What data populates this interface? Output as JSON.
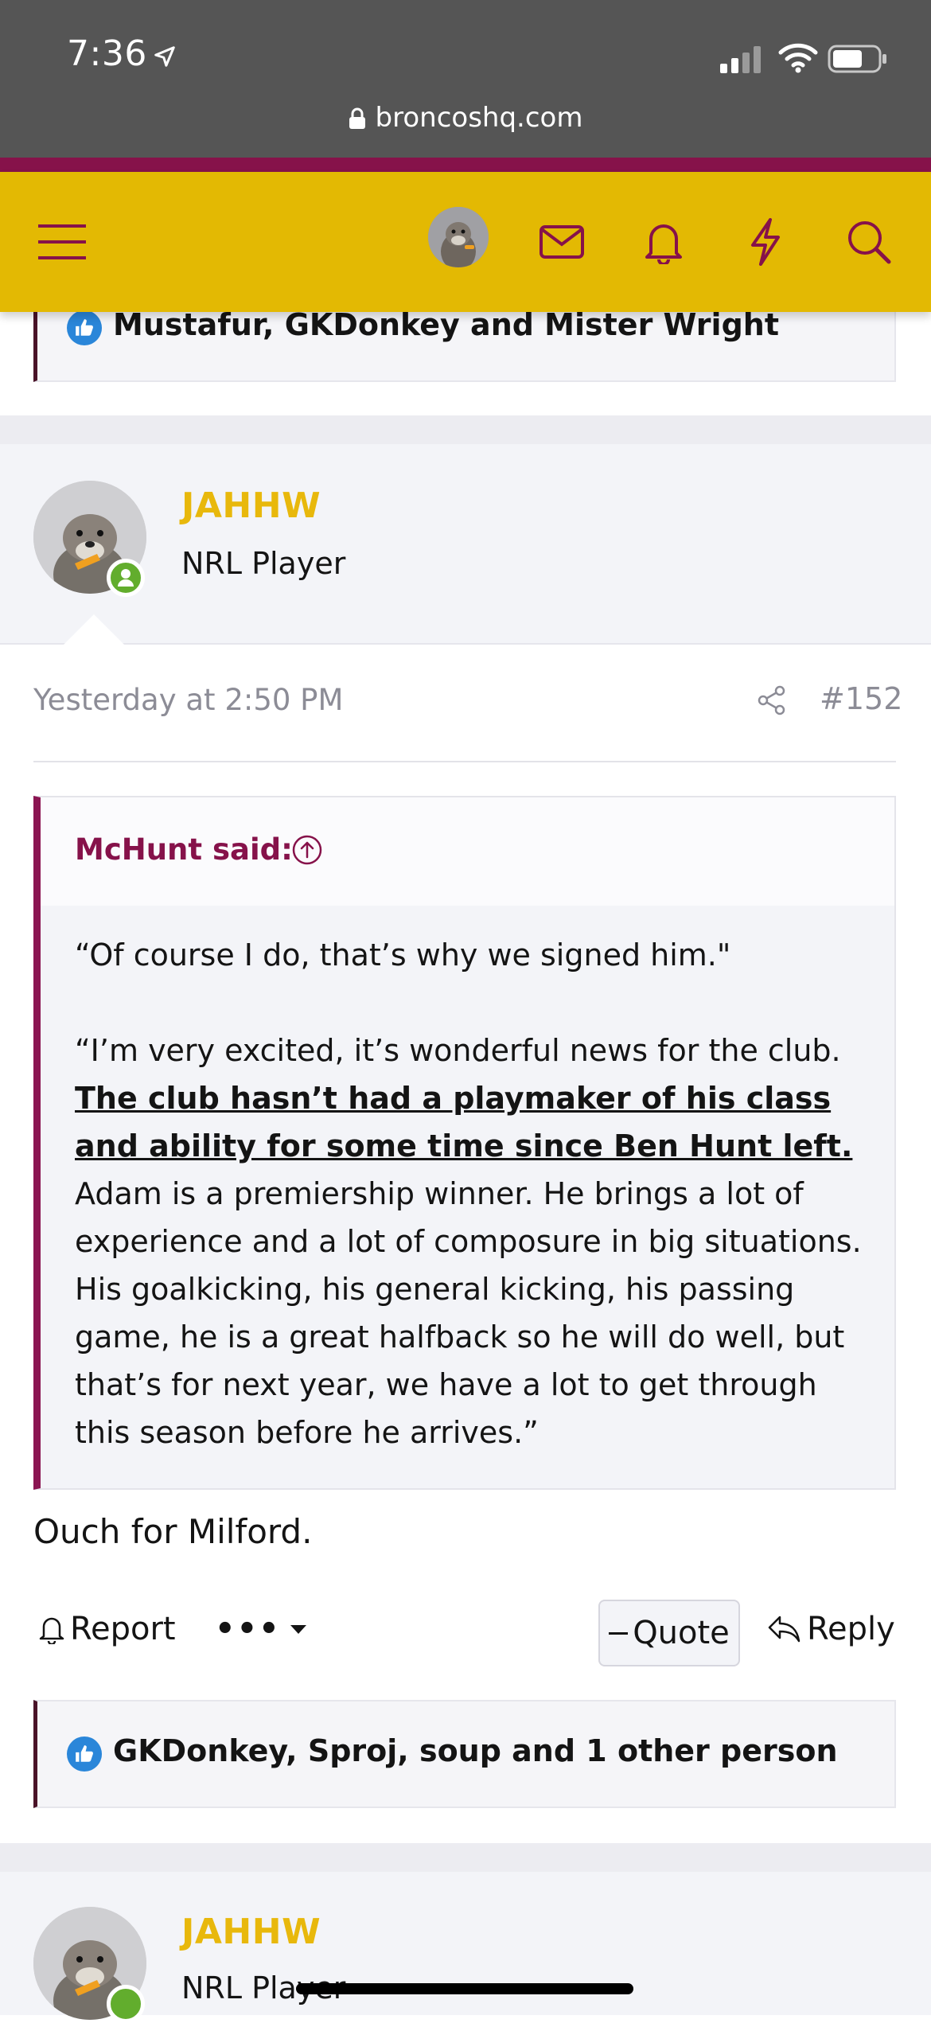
{
  "status_bar": {
    "time": "7:36",
    "url": "broncoshq.com"
  },
  "header": {
    "icons": [
      "menu-icon",
      "avatar",
      "envelope-icon",
      "bell-icon",
      "lightning-icon",
      "search-icon"
    ]
  },
  "reaction_top": {
    "text": "Mustafur, GKDonkey and Mister Wright"
  },
  "post": {
    "username": "JAHHW",
    "user_title": "NRL Player",
    "date": "Yesterday at 2:50 PM",
    "number": "#152",
    "quote": {
      "author": "McHunt said:",
      "line1": "“Of course I do, that’s why we signed him.\"",
      "para2_l1": "“I’m very excited, it’s wonderful news for the club.",
      "para2_bold": "The club hasn’t had a playmaker of his class and ability for some time since Ben Hunt left.",
      "para2_rest": " Adam is a premiership winner. He brings a lot of experience and a lot of composure in big situations. His goalkicking, his general kicking, his passing game, he is a great halfback so he will do well, but that’s for next year, we have a lot to get through this season before he arrives.”"
    },
    "text": "Ouch for Milford.",
    "actions": {
      "report": "Report",
      "more": "•••",
      "quote": "Quote",
      "reply": "Reply"
    },
    "reactions": "GKDonkey, Sproj, soup and 1 other person"
  },
  "next_post": {
    "username": "JAHHW",
    "user_title": "NRL Player"
  },
  "colors": {
    "accent": "#e3b903",
    "brand": "#86124a",
    "status_bar": "#555555"
  }
}
